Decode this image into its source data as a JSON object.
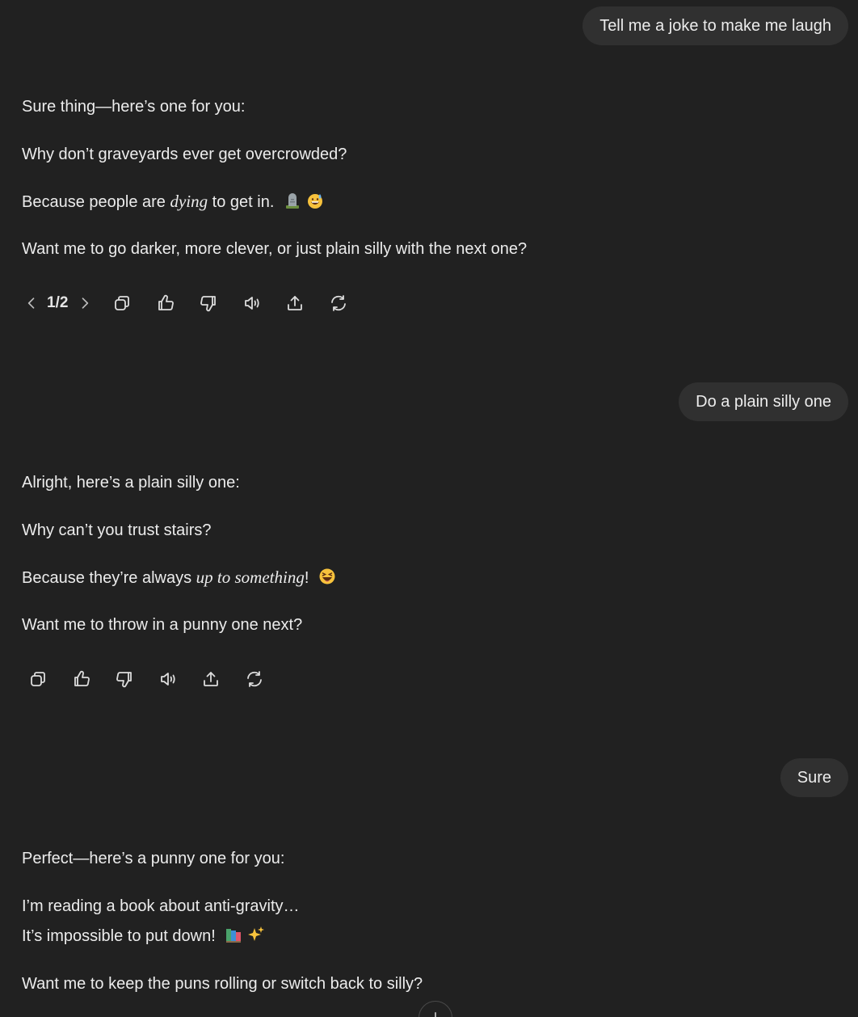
{
  "messages": [
    {
      "role": "user",
      "text": "Tell me a joke to make me laugh"
    },
    {
      "role": "assistant",
      "intro": "Sure thing—here’s one for you:",
      "question": "Why don’t graveyards ever get overcrowded?",
      "answer_pre": "Because people are ",
      "answer_em": "dying",
      "answer_post": " to get in.",
      "answer_emojis": [
        "headstone",
        "grinning-sweat"
      ],
      "followup": "Want me to go darker, more clever, or just plain silly with the next one?",
      "version": "1/2"
    },
    {
      "role": "user",
      "text": "Do a plain silly one"
    },
    {
      "role": "assistant",
      "intro": "Alright, here’s a plain silly one:",
      "question": "Why can’t you trust stairs?",
      "answer_pre": "Because they’re always ",
      "answer_em": "up to something",
      "answer_post": "!",
      "answer_emojis": [
        "squinting-laughing"
      ],
      "followup": "Want me to throw in a punny one next?"
    },
    {
      "role": "user",
      "text": "Sure"
    },
    {
      "role": "assistant",
      "intro": "Perfect—here’s a punny one for you:",
      "line1": "I’m reading a book about anti-gravity…",
      "line2": "It’s impossible to put down!",
      "line2_emojis": [
        "books",
        "sparkles"
      ],
      "followup": "Want me to keep the puns rolling or switch back to silly?"
    }
  ],
  "action_icons": [
    "copy-icon",
    "thumbs-up-icon",
    "thumbs-down-icon",
    "read-aloud-icon",
    "share-icon",
    "regenerate-icon"
  ],
  "colors": {
    "background": "#212121",
    "user_bubble": "#303030",
    "text": "#ececec"
  }
}
